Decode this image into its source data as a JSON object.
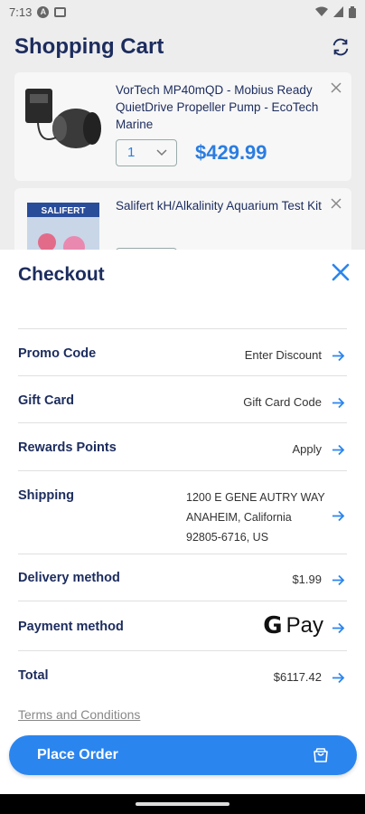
{
  "status_bar": {
    "time": "7:13"
  },
  "background": {
    "title": "Shopping Cart",
    "items": [
      {
        "name": "VorTech MP40mQD - Mobius Ready QuietDrive Propeller Pump - EcoTech Marine",
        "quantity": "1",
        "price": "$429.99"
      },
      {
        "name": "Salifert kH/Alkalinity Aquarium Test Kit",
        "brand_logo_text": "SALIFERT"
      }
    ]
  },
  "checkout": {
    "title": "Checkout",
    "rows": [
      {
        "label": "Promo Code",
        "value": "Enter Discount"
      },
      {
        "label": "Gift Card",
        "value": "Gift Card Code"
      },
      {
        "label": "Rewards Points",
        "value": "Apply"
      },
      {
        "label": "Shipping",
        "address_line1": "1200 E GENE AUTRY WAY",
        "address_line2": "ANAHEIM, California",
        "address_line3": "92805-6716, US"
      },
      {
        "label": "Delivery method",
        "value": "$1.99"
      },
      {
        "label": "Payment method",
        "payment_logo_g": "G",
        "payment_logo_pay": "Pay"
      },
      {
        "label": "Total",
        "value": "$6117.42"
      }
    ],
    "terms": "Terms and Conditions",
    "place_order": "Place Order"
  },
  "colors": {
    "accent": "#2b85ef",
    "navy": "#1c2c5e",
    "price_blue": "#2b7de0"
  }
}
